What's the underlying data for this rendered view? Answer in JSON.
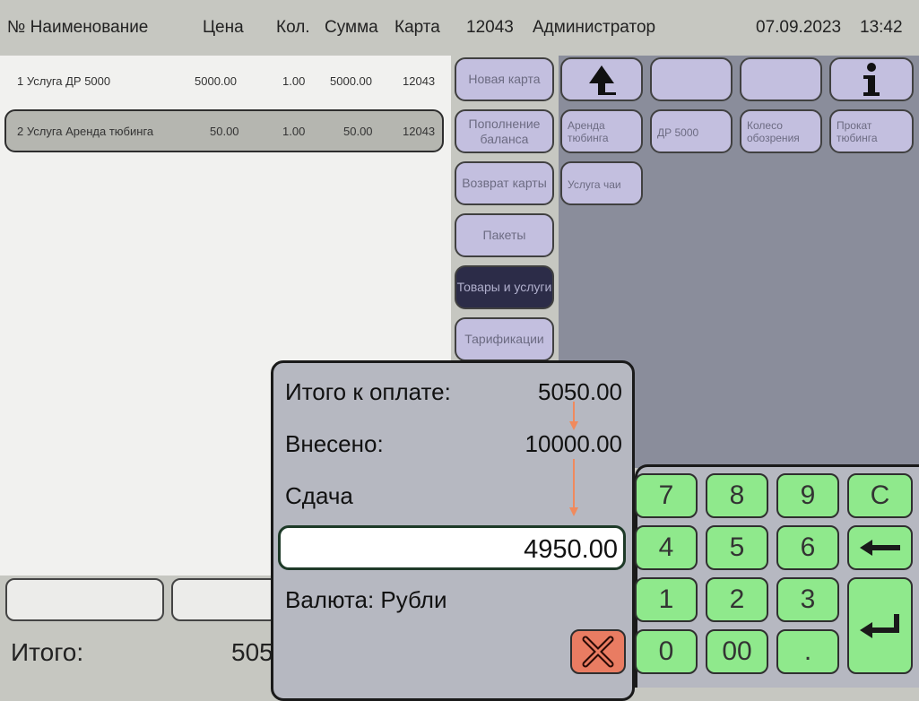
{
  "header": {
    "col_no_name": "№ Наименование",
    "col_price": "Цена",
    "col_qty": "Кол.",
    "col_sum": "Сумма",
    "col_card": "Карта",
    "card_number": "12043",
    "user": "Администратор",
    "date": "07.09.2023",
    "time": "13:42"
  },
  "order_items": [
    {
      "name": "1 Услуга ДР 5000",
      "price": "5000.00",
      "qty": "1.00",
      "sum": "5000.00",
      "card": "12043"
    },
    {
      "name": "2 Услуга Аренда тюбинга",
      "price": "50.00",
      "qty": "1.00",
      "sum": "50.00",
      "card": "12043"
    }
  ],
  "footer": {
    "total_label": "Итого:",
    "total_value": "505"
  },
  "categories": [
    {
      "label": "Новая карта"
    },
    {
      "label": "Пополнение баланса"
    },
    {
      "label": "Возврат карты"
    },
    {
      "label": "Пакеты"
    },
    {
      "label": "Товары и услуги"
    },
    {
      "label": "Тарификации"
    }
  ],
  "products": [
    {
      "label": "Аренда тюбинга"
    },
    {
      "label": "ДР 5000"
    },
    {
      "label": "Колесо обозрения"
    },
    {
      "label": "Прокат тюбинга"
    },
    {
      "label": "Услуга чаи"
    }
  ],
  "payment": {
    "total_due_label": "Итого к оплате:",
    "total_due_value": "5050.00",
    "paid_label": "Внесено:",
    "paid_value": "10000.00",
    "change_label": "Сдача",
    "change_value": "4950.00",
    "currency_label": "Валюта: Рубли"
  },
  "keypad": {
    "k7": "7",
    "k8": "8",
    "k9": "9",
    "clear": "C",
    "k4": "4",
    "k5": "5",
    "k6": "6",
    "k1": "1",
    "k2": "2",
    "k3": "3",
    "k0": "0",
    "k00": "00",
    "dot": "."
  },
  "colors": {
    "keypad_green": "#8fe98c",
    "cancel_red": "#e97c62",
    "annotation_arrow": "#f08a5d"
  }
}
